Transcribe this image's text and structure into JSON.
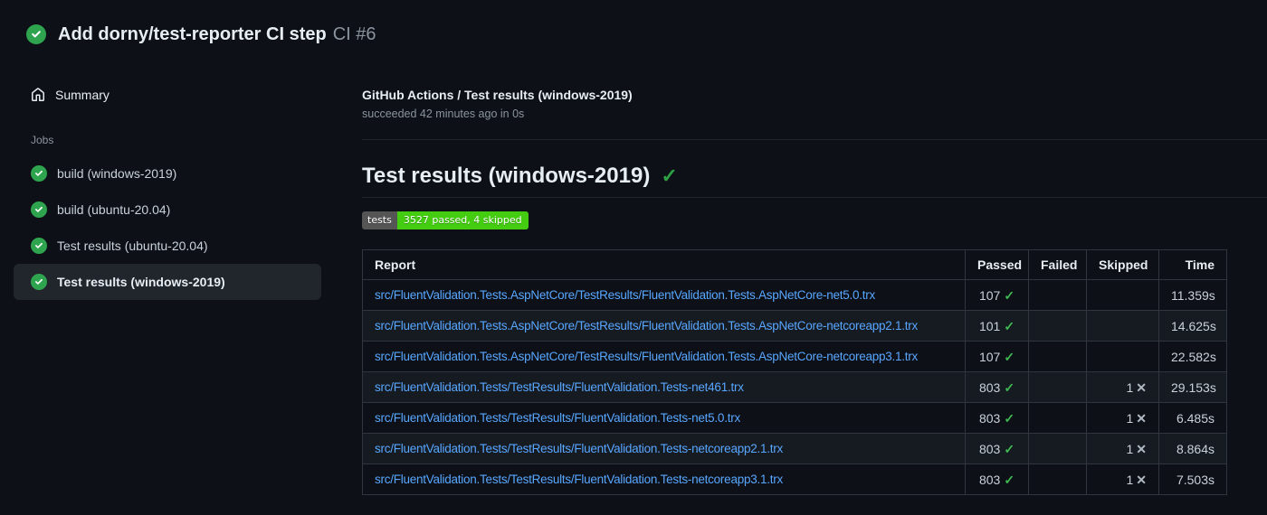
{
  "header": {
    "title": "Add dorny/test-reporter CI step",
    "run_number": "CI #6"
  },
  "sidebar": {
    "summary_label": "Summary",
    "jobs_label": "Jobs",
    "jobs": [
      {
        "label": "build (windows-2019)",
        "status": "success"
      },
      {
        "label": "build (ubuntu-20.04)",
        "status": "success"
      },
      {
        "label": "Test results (ubuntu-20.04)",
        "status": "success"
      },
      {
        "label": "Test results (windows-2019)",
        "status": "success",
        "selected": true
      }
    ]
  },
  "main": {
    "run_title": "GitHub Actions / Test results (windows-2019)",
    "run_subtitle": "succeeded 42 minutes ago in 0s",
    "section_title": "Test results (windows-2019)",
    "section_status_icon": "check-icon",
    "badge": {
      "label": "tests",
      "value": "3527 passed, 4 skipped",
      "label_bg": "#555555",
      "value_bg": "#44cc11"
    },
    "table": {
      "columns": [
        "Report",
        "Passed",
        "Failed",
        "Skipped",
        "Time"
      ],
      "rows": [
        {
          "report": "src/FluentValidation.Tests.AspNetCore/TestResults/FluentValidation.Tests.AspNetCore-net5.0.trx",
          "passed": "107",
          "failed": "",
          "skipped": "",
          "time": "11.359s"
        },
        {
          "report": "src/FluentValidation.Tests.AspNetCore/TestResults/FluentValidation.Tests.AspNetCore-netcoreapp2.1.trx",
          "passed": "101",
          "failed": "",
          "skipped": "",
          "time": "14.625s"
        },
        {
          "report": "src/FluentValidation.Tests.AspNetCore/TestResults/FluentValidation.Tests.AspNetCore-netcoreapp3.1.trx",
          "passed": "107",
          "failed": "",
          "skipped": "",
          "time": "22.582s"
        },
        {
          "report": "src/FluentValidation.Tests/TestResults/FluentValidation.Tests-net461.trx",
          "passed": "803",
          "failed": "",
          "skipped": "1",
          "time": "29.153s"
        },
        {
          "report": "src/FluentValidation.Tests/TestResults/FluentValidation.Tests-net5.0.trx",
          "passed": "803",
          "failed": "",
          "skipped": "1",
          "time": "6.485s"
        },
        {
          "report": "src/FluentValidation.Tests/TestResults/FluentValidation.Tests-netcoreapp2.1.trx",
          "passed": "803",
          "failed": "",
          "skipped": "1",
          "time": "8.864s"
        },
        {
          "report": "src/FluentValidation.Tests/TestResults/FluentValidation.Tests-netcoreapp3.1.trx",
          "passed": "803",
          "failed": "",
          "skipped": "1",
          "time": "7.503s"
        }
      ]
    }
  },
  "colors": {
    "background": "#0d1117",
    "row_alt": "#161b22",
    "border": "#30363d",
    "divider": "#21262d",
    "link": "#58a6ff",
    "success_green": "#2ea44f",
    "check_green": "#3fb950",
    "muted_text": "#8b949e"
  },
  "glyphs": {
    "check": "✓",
    "cross": "✕"
  }
}
